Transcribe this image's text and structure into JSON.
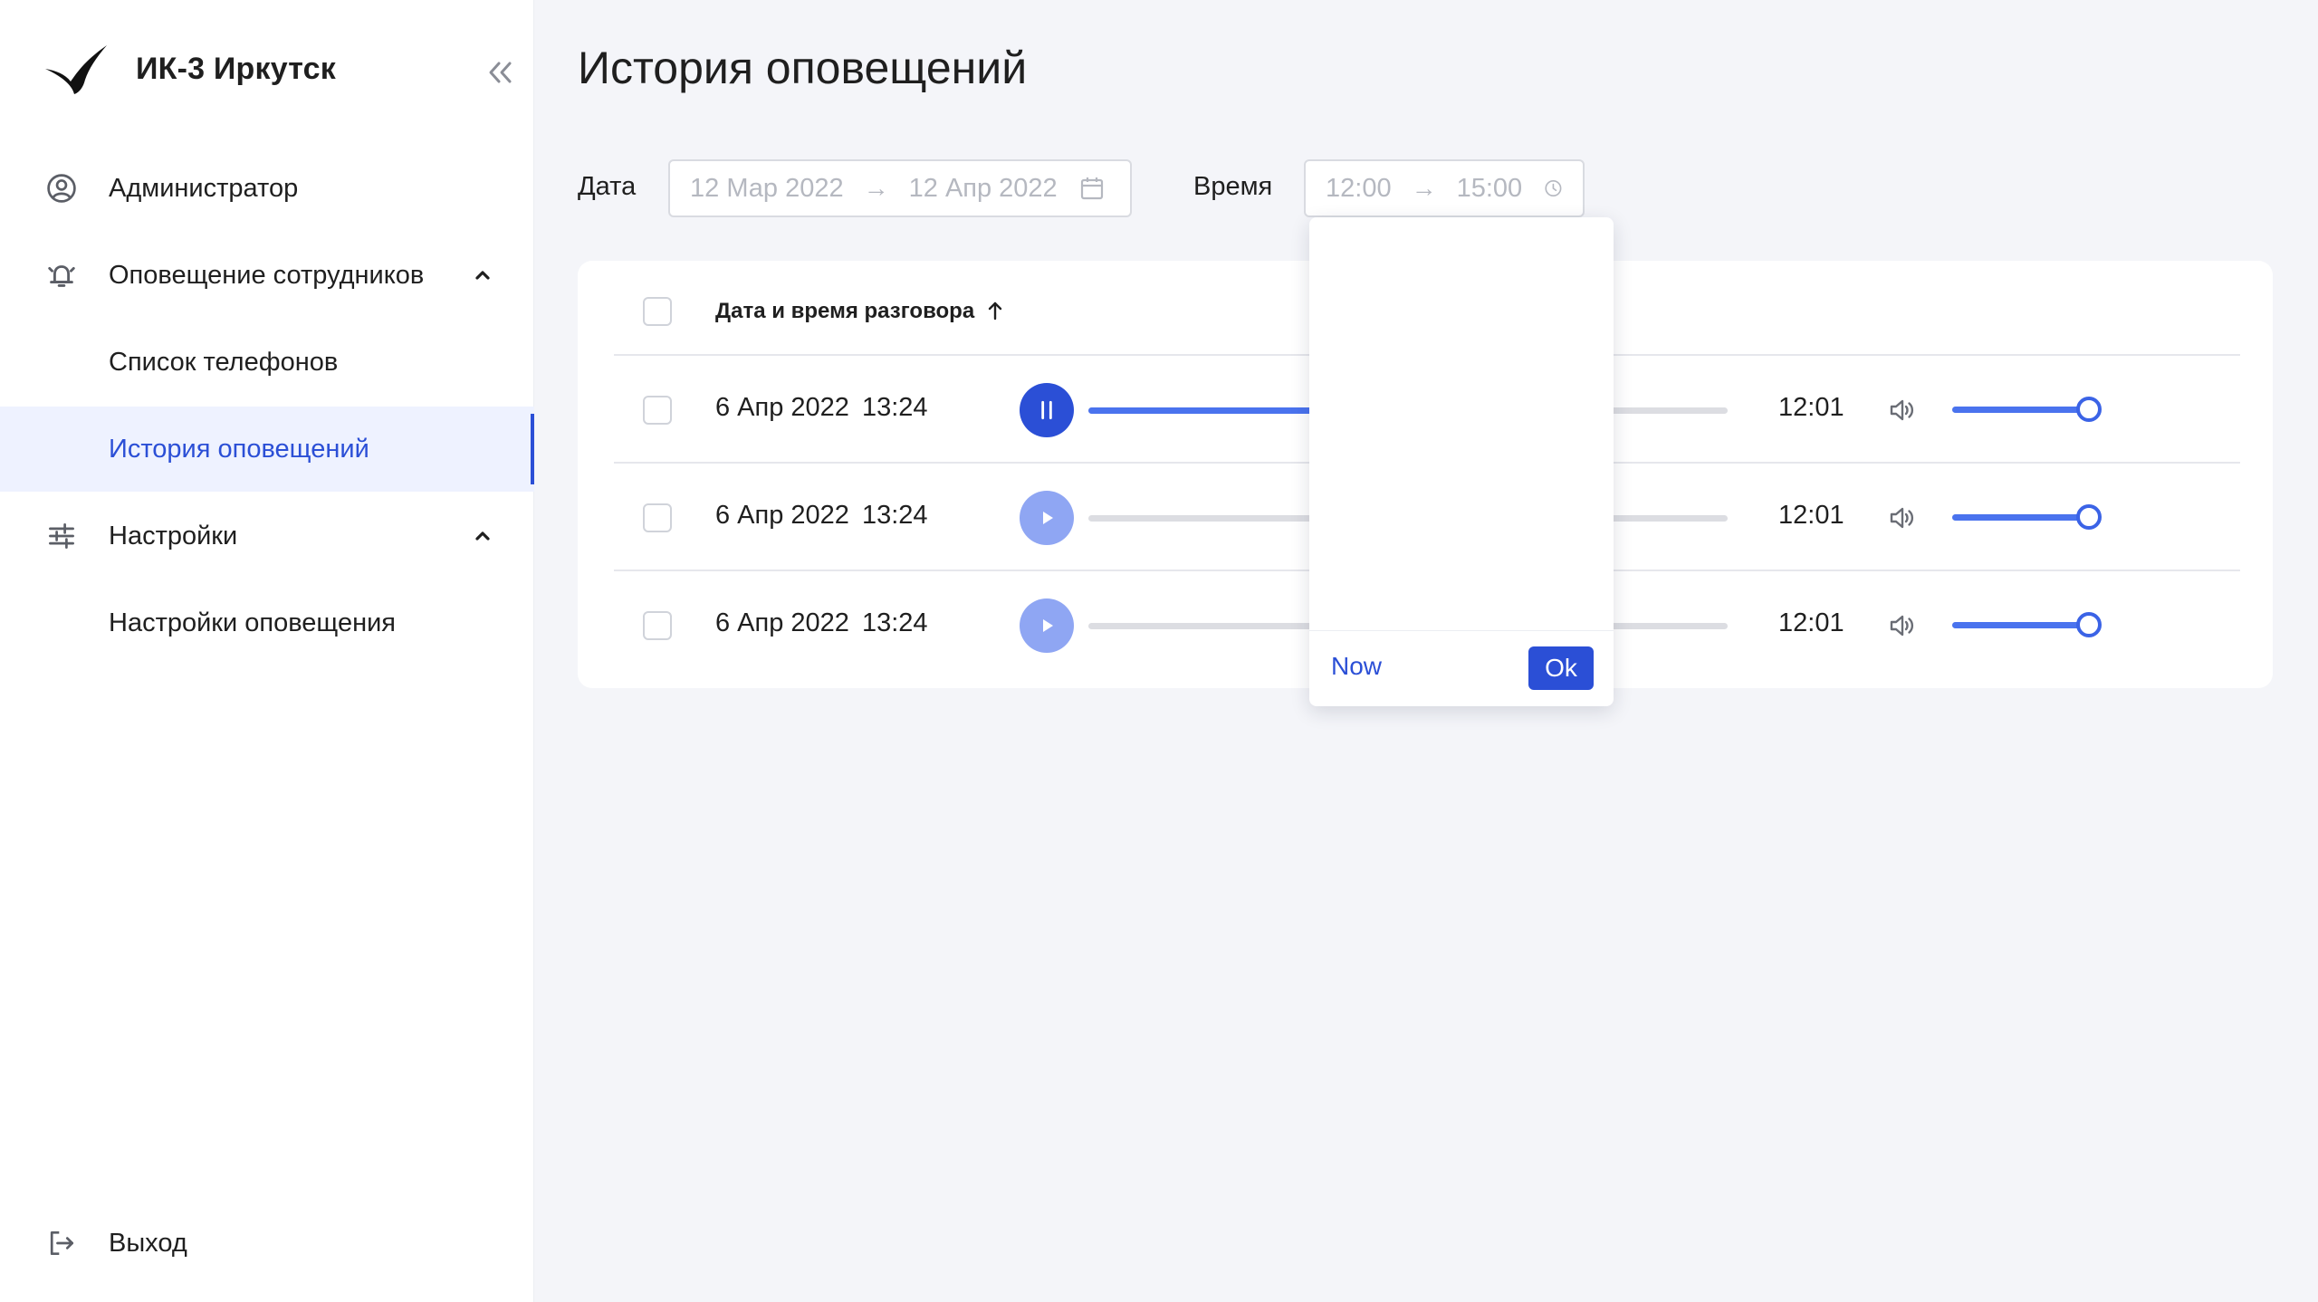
{
  "sidebar": {
    "brand_name": "ИК-3 Иркутск",
    "items": [
      {
        "label": "Администратор"
      },
      {
        "label": "Оповещение сотрудников"
      },
      {
        "label": "Список телефонов"
      },
      {
        "label": "История оповещений"
      },
      {
        "label": "Настройки"
      },
      {
        "label": "Настройки оповещения"
      }
    ],
    "logout_label": "Выход",
    "active_item": "История оповещений"
  },
  "page": {
    "title": "История оповещений"
  },
  "filters": {
    "date_label": "Дата",
    "date_from": "12 Мар 2022",
    "date_to": "12 Апр 2022",
    "time_label": "Время",
    "time_from": "12:00",
    "time_to": "15:00",
    "range_separator": "→"
  },
  "table": {
    "column_header": "Дата и время разговора",
    "sort_direction": "ascending",
    "rows": [
      {
        "date": "6 Апр 2022",
        "time": "13:24",
        "duration": "12:01",
        "state": "playing",
        "progress": 0.37,
        "volume": 0.92
      },
      {
        "date": "6 Апр 2022",
        "time": "13:24",
        "duration": "12:01",
        "state": "paused",
        "progress": 0,
        "volume": 0.92
      },
      {
        "date": "6 Апр 2022",
        "time": "13:24",
        "duration": "12:01",
        "state": "paused",
        "progress": 0,
        "volume": 0.92
      }
    ]
  },
  "time_picker": {
    "now_label": "Now",
    "ok_label": "Ok"
  },
  "colors": {
    "accent": "#2b4fd6",
    "accent_light": "#8fa6f3",
    "active_bg": "#eef2ff",
    "page_bg": "#f4f5f9"
  },
  "icons": {
    "logo": "bird-logo-icon",
    "collapse": "double-chevron-left-icon",
    "admin": "user-circle-icon",
    "alerts": "bell-ring-icon",
    "settings": "sliders-icon",
    "logout": "logout-icon",
    "calendar": "calendar-icon",
    "clock": "clock-icon",
    "sort": "arrow-up-icon",
    "pause": "pause-icon",
    "play": "play-icon",
    "volume": "volume-icon"
  }
}
